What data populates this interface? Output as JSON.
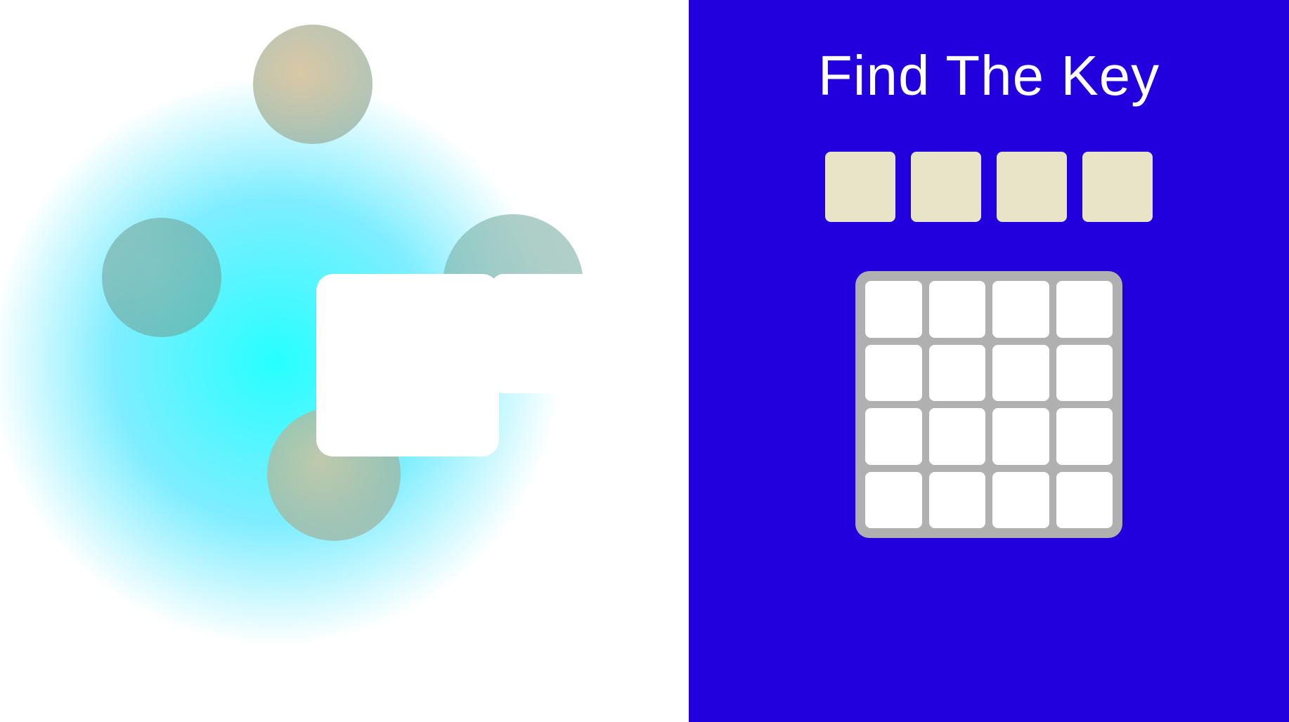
{
  "left_panel": {
    "background": "#ffffff"
  },
  "right_panel": {
    "background": "#2200dd",
    "title": "Find The Key",
    "key_slots": [
      {
        "id": 1,
        "color": "#e8e4c8"
      },
      {
        "id": 2,
        "color": "#e8e4c8"
      },
      {
        "id": 3,
        "color": "#e8e4c8"
      },
      {
        "id": 4,
        "color": "#e8e4c8"
      }
    ],
    "grid": {
      "rows": 4,
      "cols": 4,
      "cell_color": "#ffffff",
      "border_color": "#b0b0b0"
    }
  }
}
